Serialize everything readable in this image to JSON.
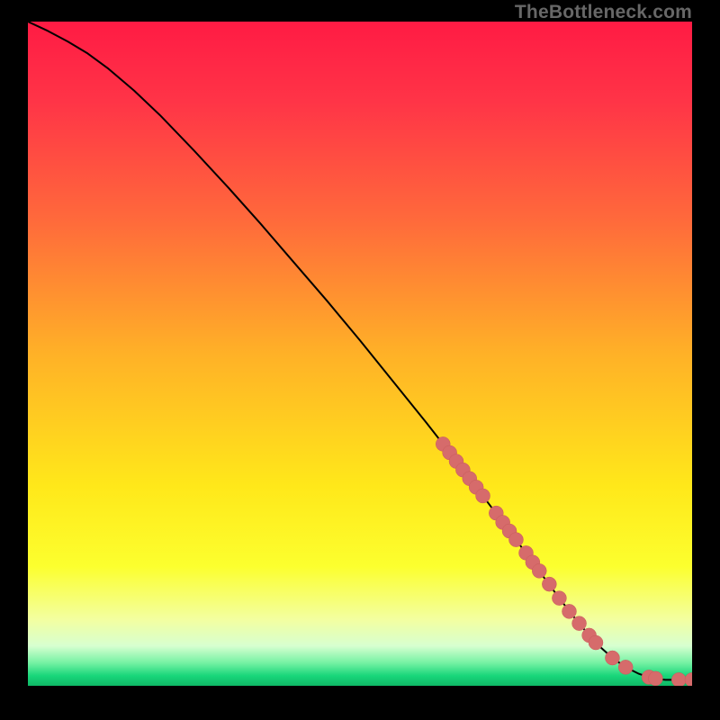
{
  "attribution": "TheBottleneck.com",
  "colors": {
    "gradient_stops": [
      {
        "offset": 0.0,
        "color": "#ff1b44"
      },
      {
        "offset": 0.12,
        "color": "#ff3447"
      },
      {
        "offset": 0.3,
        "color": "#ff6a3b"
      },
      {
        "offset": 0.5,
        "color": "#ffb127"
      },
      {
        "offset": 0.7,
        "color": "#ffe81a"
      },
      {
        "offset": 0.82,
        "color": "#fcff2e"
      },
      {
        "offset": 0.9,
        "color": "#f3ffa0"
      },
      {
        "offset": 0.94,
        "color": "#d7ffd0"
      },
      {
        "offset": 0.965,
        "color": "#77f2a4"
      },
      {
        "offset": 0.985,
        "color": "#18d67a"
      },
      {
        "offset": 1.0,
        "color": "#0fb866"
      }
    ],
    "line": "#000000",
    "marker": "#d66b6b",
    "marker_stroke": "#c85a5a"
  },
  "chart_data": {
    "type": "line",
    "title": "",
    "xlabel": "",
    "ylabel": "",
    "xlim": [
      0,
      100
    ],
    "ylim": [
      0,
      100
    ],
    "grid": false,
    "legend": false,
    "axes_visible": false,
    "series": [
      {
        "name": "curve",
        "x": [
          0,
          3,
          6,
          9,
          12,
          16,
          20,
          25,
          30,
          35,
          40,
          45,
          50,
          55,
          60,
          65,
          70,
          72,
          74,
          76,
          78,
          80,
          82,
          84,
          86,
          88,
          90,
          92,
          93.5,
          95,
          96,
          97,
          98,
          100
        ],
        "y": [
          100,
          98.6,
          97.0,
          95.2,
          93.0,
          89.6,
          85.8,
          80.6,
          75.2,
          69.6,
          63.8,
          58.0,
          52.0,
          45.8,
          39.6,
          33.2,
          26.6,
          24.0,
          21.3,
          18.6,
          15.9,
          13.2,
          10.6,
          8.2,
          6.0,
          4.2,
          2.8,
          1.8,
          1.3,
          1.0,
          0.9,
          0.9,
          0.9,
          0.9
        ]
      }
    ],
    "markers": {
      "name": "highlighted-points",
      "note": "large salmon dots clustered along the lower-right segment of the curve",
      "x": [
        62.5,
        63.5,
        64.5,
        65.5,
        66.5,
        67.5,
        68.5,
        70.5,
        71.5,
        72.5,
        73.5,
        75.0,
        76.0,
        77.0,
        78.5,
        80.0,
        81.5,
        83.0,
        84.5,
        85.5,
        88.0,
        90.0,
        93.5,
        94.5,
        98.0,
        100.0
      ],
      "y": [
        36.4,
        35.1,
        33.8,
        32.5,
        31.2,
        29.9,
        28.6,
        26.0,
        24.6,
        23.3,
        22.0,
        20.0,
        18.6,
        17.3,
        15.3,
        13.2,
        11.2,
        9.4,
        7.6,
        6.5,
        4.2,
        2.8,
        1.3,
        1.1,
        0.9,
        0.9
      ],
      "r": 8
    }
  }
}
